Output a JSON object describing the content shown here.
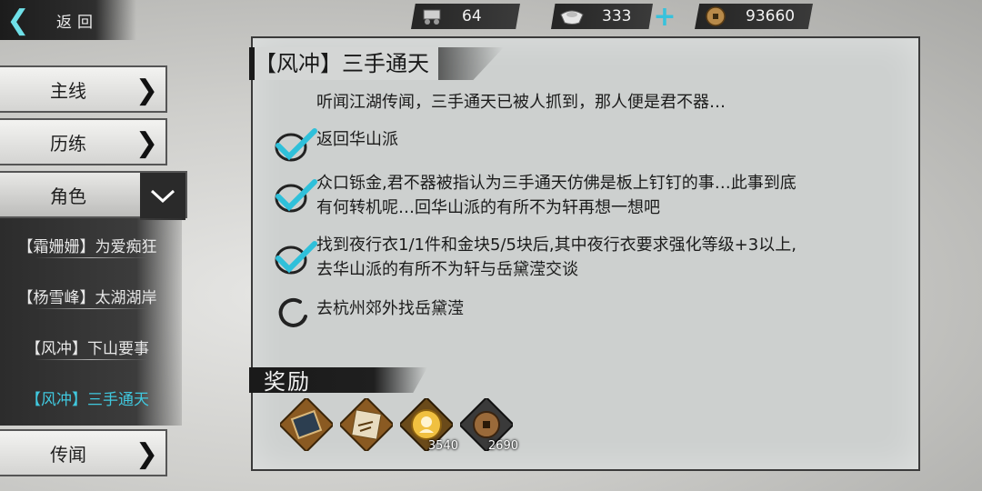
{
  "nav": {
    "back_label": "返回"
  },
  "resources": [
    {
      "icon": "cart-icon",
      "value": "64"
    },
    {
      "icon": "silver-ingot-icon",
      "value": "333"
    },
    {
      "icon": "copper-coin-icon",
      "value": "93660"
    }
  ],
  "sidebar": {
    "categories": [
      {
        "label": "主线"
      },
      {
        "label": "历练"
      },
      {
        "label": "角色"
      },
      {
        "label": "传闻"
      }
    ],
    "quests": [
      {
        "label": "【霜姗姗】为爱痴狂"
      },
      {
        "label": "【杨雪峰】太湖湖岸"
      },
      {
        "label": "【风冲】下山要事"
      },
      {
        "label": "【风冲】三手通天"
      }
    ]
  },
  "quest": {
    "title": "【风冲】三手通天",
    "intro": "听闻江湖传闻，三手通天已被人抓到，那人便是君不器…",
    "steps": [
      {
        "status": "done",
        "line1": "返回华山派",
        "line2": ""
      },
      {
        "status": "done",
        "line1": "众口铄金,君不器被指认为三手通天仿佛是板上钉钉的事…此事到底",
        "line2": "有何转机呢…回华山派的有所不为轩再想一想吧"
      },
      {
        "status": "done",
        "line1": "找到夜行衣1/1件和金块5/5块后,其中夜行衣要求强化等级+3以上,",
        "line2": "去华山派的有所不为轩与岳黛滢交谈"
      },
      {
        "status": "in-progress",
        "line1": "去杭州郊外找岳黛滢",
        "line2": ""
      }
    ]
  },
  "reward": {
    "title": "奖励",
    "items": [
      {
        "icon": "book-icon",
        "count": ""
      },
      {
        "icon": "martial-manual-icon",
        "count": ""
      },
      {
        "icon": "experience-orb-icon",
        "count": "3540"
      },
      {
        "icon": "copper-coin-icon",
        "count": "2690"
      }
    ]
  },
  "colors": {
    "accent": "#40c8de",
    "check": "#2fc0da",
    "panel": "#cdd0cf"
  }
}
